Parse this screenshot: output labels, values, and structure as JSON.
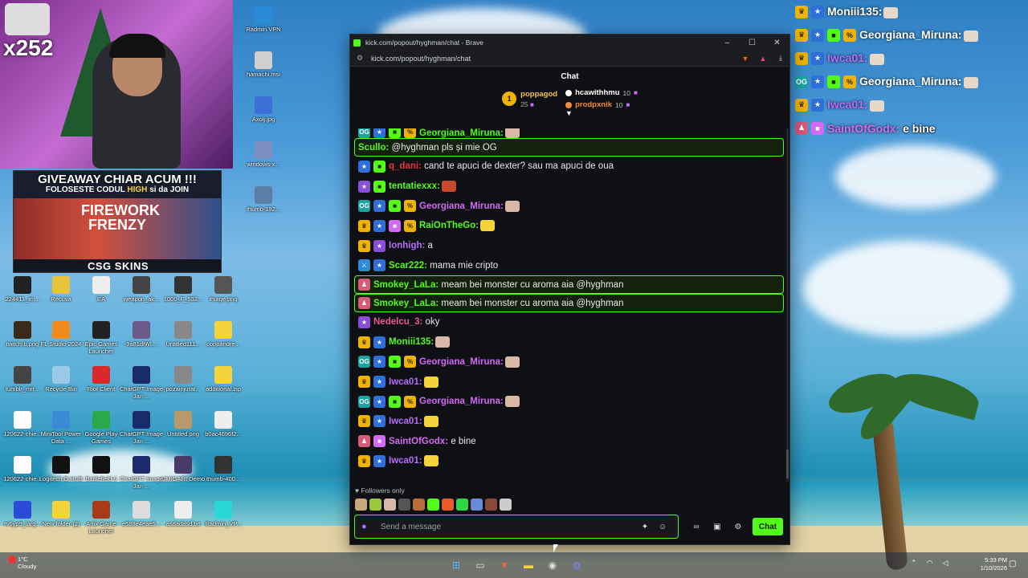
{
  "webcam": {
    "multiplier": "x252"
  },
  "giveaway": {
    "title": "GIVEAWAY CHIAR ACUM !!!",
    "subtitle_pre": "FOLOSESTE CODUL",
    "subtitle_code": "HIGH",
    "subtitle_post": "si da JOIN",
    "game": "FIREWORK FRENZY",
    "brand": "CSG SKINS"
  },
  "desktop_icons": [
    {
      "label": "Radmin VPN",
      "color": "#2a8cd8"
    },
    {
      "label": "hamachi.msi",
      "color": "#cfcfcf"
    },
    {
      "label": "Axolj.jpg",
      "color": "#3d6fd8"
    },
    {
      "label": "windows-x...",
      "color": "#7a8fbf"
    },
    {
      "label": "thumb-192...",
      "color": "#5a7fa8"
    },
    {
      "label": "224411_im...",
      "color": "#222"
    },
    {
      "label": "Recuva",
      "color": "#e8c23a"
    },
    {
      "label": "EA",
      "color": "#eee"
    },
    {
      "label": "weapon_ak...",
      "color": "#444"
    },
    {
      "label": "1000_F_592...",
      "color": "#333"
    },
    {
      "label": "image.png",
      "color": "#555"
    },
    {
      "label": "twitch-b.png",
      "color": "#3a2a1a"
    },
    {
      "label": "FL Studio 2024",
      "color": "#f08a1a"
    },
    {
      "label": "Epic Games Launcher",
      "color": "#222"
    },
    {
      "label": "-9a81dlWL...",
      "color": "#6a5a8a"
    },
    {
      "label": "Untitled111...",
      "color": "#888"
    },
    {
      "label": "coopandre...",
      "color": "#f5d33a"
    },
    {
      "label": "tumblr_mrr...",
      "color": "#444"
    },
    {
      "label": "Recycle Bin",
      "color": "#9ac8e8"
    },
    {
      "label": "Riot Client",
      "color": "#d82a2a"
    },
    {
      "label": "ChatGPT Image Jan ...",
      "color": "#1a2a6a"
    },
    {
      "label": "pozainjurat...",
      "color": "#888"
    },
    {
      "label": "additional.zip",
      "color": "#f5d33a"
    },
    {
      "label": "120622-chie...",
      "color": "#fff"
    },
    {
      "label": "MiniTool Power Data ...",
      "color": "#3a8ad8"
    },
    {
      "label": "Google Play Games",
      "color": "#2aa84a"
    },
    {
      "label": "ChatGPT Image Jan ...",
      "color": "#1a2a6a"
    },
    {
      "label": "Untitled.png",
      "color": "#b89a6a"
    },
    {
      "label": "b0ac4696f2...",
      "color": "#eee"
    },
    {
      "label": "120622-chie...",
      "color": "#fff"
    },
    {
      "label": "Logitech G HUB",
      "color": "#111"
    },
    {
      "label": "Battlefield 6",
      "color": "#111"
    },
    {
      "label": "ChatGPT Image Jan ...",
      "color": "#1a2a6a"
    },
    {
      "label": "UMIGARI Demo",
      "color": "#4a3a6a"
    },
    {
      "label": "thumb-400...",
      "color": "#333"
    },
    {
      "label": "rv6yp9_larg...",
      "color": "#2a4ad8"
    },
    {
      "label": "New folder (2)",
      "color": "#f5d33a"
    },
    {
      "label": "Artix Game Launcher",
      "color": "#a83a1a"
    },
    {
      "label": "e588e4eae5...",
      "color": "#ddd"
    },
    {
      "label": "asdadasd.txt",
      "color": "#eee"
    },
    {
      "label": "Radmin_VP...",
      "color": "#2ad8d8"
    }
  ],
  "overlay_chat": [
    {
      "user": "Moniii135:",
      "user_color": "#ffffff",
      "text": "",
      "badges": [
        "vip",
        "sub"
      ]
    },
    {
      "user": "Georgiana_Miruna:",
      "user_color": "#ffffff",
      "text": "",
      "badges": [
        "vip",
        "sub",
        "gift",
        "mult"
      ]
    },
    {
      "user": "Iwca01:",
      "user_color": "#b86cff",
      "text": "",
      "badges": [
        "vip",
        "sub"
      ]
    },
    {
      "user": "Georgiana_Miruna:",
      "user_color": "#ffffff",
      "text": "",
      "badges": [
        "og",
        "sub",
        "gift",
        "mult"
      ]
    },
    {
      "user": "Iwca01:",
      "user_color": "#b86cff",
      "text": "",
      "badges": [
        "vip",
        "sub"
      ]
    },
    {
      "user": "SaintOfGodx:",
      "user_color": "#d26af5",
      "text": "e bine",
      "badges": [
        "red",
        "gift2"
      ]
    }
  ],
  "browser": {
    "title": "kick.com/popout/hyghman/chat - Brave",
    "url": "kick.com/popout/hyghman/chat",
    "minimize": "–",
    "maximize": "☐",
    "close": "✕"
  },
  "chat": {
    "header": "Chat",
    "leaderboard": {
      "first": {
        "rank": "1",
        "name": "poppagod",
        "count": "25"
      },
      "others": [
        {
          "name": "hcawithhmu",
          "count": "10",
          "color": "#ffffff",
          "dot": "#ffffff"
        },
        {
          "name": "prodpxnik",
          "count": "10",
          "color": "#f08a3a",
          "dot": "#f08a3a"
        }
      ]
    },
    "messages": [
      {
        "user": "Georgiana_Miruna:",
        "user_color": "#53fc18",
        "text": "",
        "badges": [
          "og",
          "sub",
          "gift",
          "mult"
        ],
        "emote": "#d9b8a8",
        "hl": false
      },
      {
        "user": "Scullo:",
        "user_color": "#53fc18",
        "text": "@hyghman pls și mie OG",
        "badges": [],
        "emote": "",
        "hl": true
      },
      {
        "user": "q_dani:",
        "user_color": "#e03a3a",
        "text": "cand te apuci de dexter? sau ma apuci de oua",
        "badges": [
          "sub",
          "gift"
        ],
        "emote": "",
        "hl": false
      },
      {
        "user": "tentatiexxx:",
        "user_color": "#53fc18",
        "text": "",
        "badges": [
          "sub2",
          "gift"
        ],
        "emote": "#c84a2a",
        "hl": false
      },
      {
        "user": "Georgiana_Miruna:",
        "user_color": "#d26af5",
        "text": "",
        "badges": [
          "og",
          "sub",
          "gift",
          "mult"
        ],
        "emote": "#d9b8a8",
        "hl": false
      },
      {
        "user": "RaiOnTheGo:",
        "user_color": "#53fc18",
        "text": "",
        "badges": [
          "vip",
          "sub",
          "gift2",
          "mult"
        ],
        "emote": "#f5d33a",
        "hl": false
      },
      {
        "user": "Ionhigh:",
        "user_color": "#b86cff",
        "text": "a",
        "badges": [
          "vip",
          "sub2"
        ],
        "emote": "",
        "hl": false
      },
      {
        "user": "Scar222:",
        "user_color": "#53fc18",
        "text": "mama mie cripto",
        "badges": [
          "mod",
          "sub"
        ],
        "emote": "",
        "hl": false
      },
      {
        "user": "Smokey_LaLa:",
        "user_color": "#53fc18",
        "text": "meam bei monster cu aroma aia @hyghman",
        "badges": [
          "red"
        ],
        "emote": "",
        "hl": true
      },
      {
        "user": "Smokey_LaLa:",
        "user_color": "#53fc18",
        "text": "meam bei monster cu aroma aia @hyghman",
        "badges": [
          "red"
        ],
        "emote": "",
        "hl": true
      },
      {
        "user": "Nedelcu_3:",
        "user_color": "#e85a8a",
        "text": "oky",
        "badges": [
          "sub2"
        ],
        "emote": "",
        "hl": false
      },
      {
        "user": "Moniii135:",
        "user_color": "#53fc18",
        "text": "",
        "badges": [
          "vip",
          "sub"
        ],
        "emote": "#d9b8a8",
        "hl": false
      },
      {
        "user": "Georgiana_Miruna:",
        "user_color": "#d26af5",
        "text": "",
        "badges": [
          "og",
          "sub",
          "gift",
          "mult"
        ],
        "emote": "#d9b8a8",
        "hl": false
      },
      {
        "user": "Iwca01:",
        "user_color": "#b86cff",
        "text": "",
        "badges": [
          "vip",
          "sub"
        ],
        "emote": "#f5d33a",
        "hl": false
      },
      {
        "user": "Georgiana_Miruna:",
        "user_color": "#d26af5",
        "text": "",
        "badges": [
          "og",
          "sub",
          "gift",
          "mult"
        ],
        "emote": "#d9b8a8",
        "hl": false
      },
      {
        "user": "Iwca01:",
        "user_color": "#b86cff",
        "text": "",
        "badges": [
          "vip",
          "sub"
        ],
        "emote": "#f5d33a",
        "hl": false
      },
      {
        "user": "SaintOfGodx:",
        "user_color": "#d26af5",
        "text": "e bine",
        "badges": [
          "red",
          "gift2"
        ],
        "emote": "",
        "hl": false
      },
      {
        "user": "Iwca01:",
        "user_color": "#b86cff",
        "text": "",
        "badges": [
          "vip",
          "sub"
        ],
        "emote": "#f5d33a",
        "hl": false
      }
    ],
    "followers_only": "Followers only",
    "emote_bar_colors": [
      "#c8a878",
      "#9ac83a",
      "#d8b8a8",
      "#555",
      "#b86c3a",
      "#53fc18",
      "#e85a2a",
      "#2ad84a",
      "#6a8ad8",
      "#8a4a3a",
      "#ccc"
    ],
    "input_placeholder": "Send a message",
    "send_label": "Chat"
  },
  "taskbar": {
    "weather_temp": "1°C",
    "weather_desc": "Cloudy",
    "time": "5:33 PM",
    "date": "1/10/2026"
  },
  "colors": {
    "kick_green": "#53fc18",
    "chat_bg": "#0e1013"
  }
}
